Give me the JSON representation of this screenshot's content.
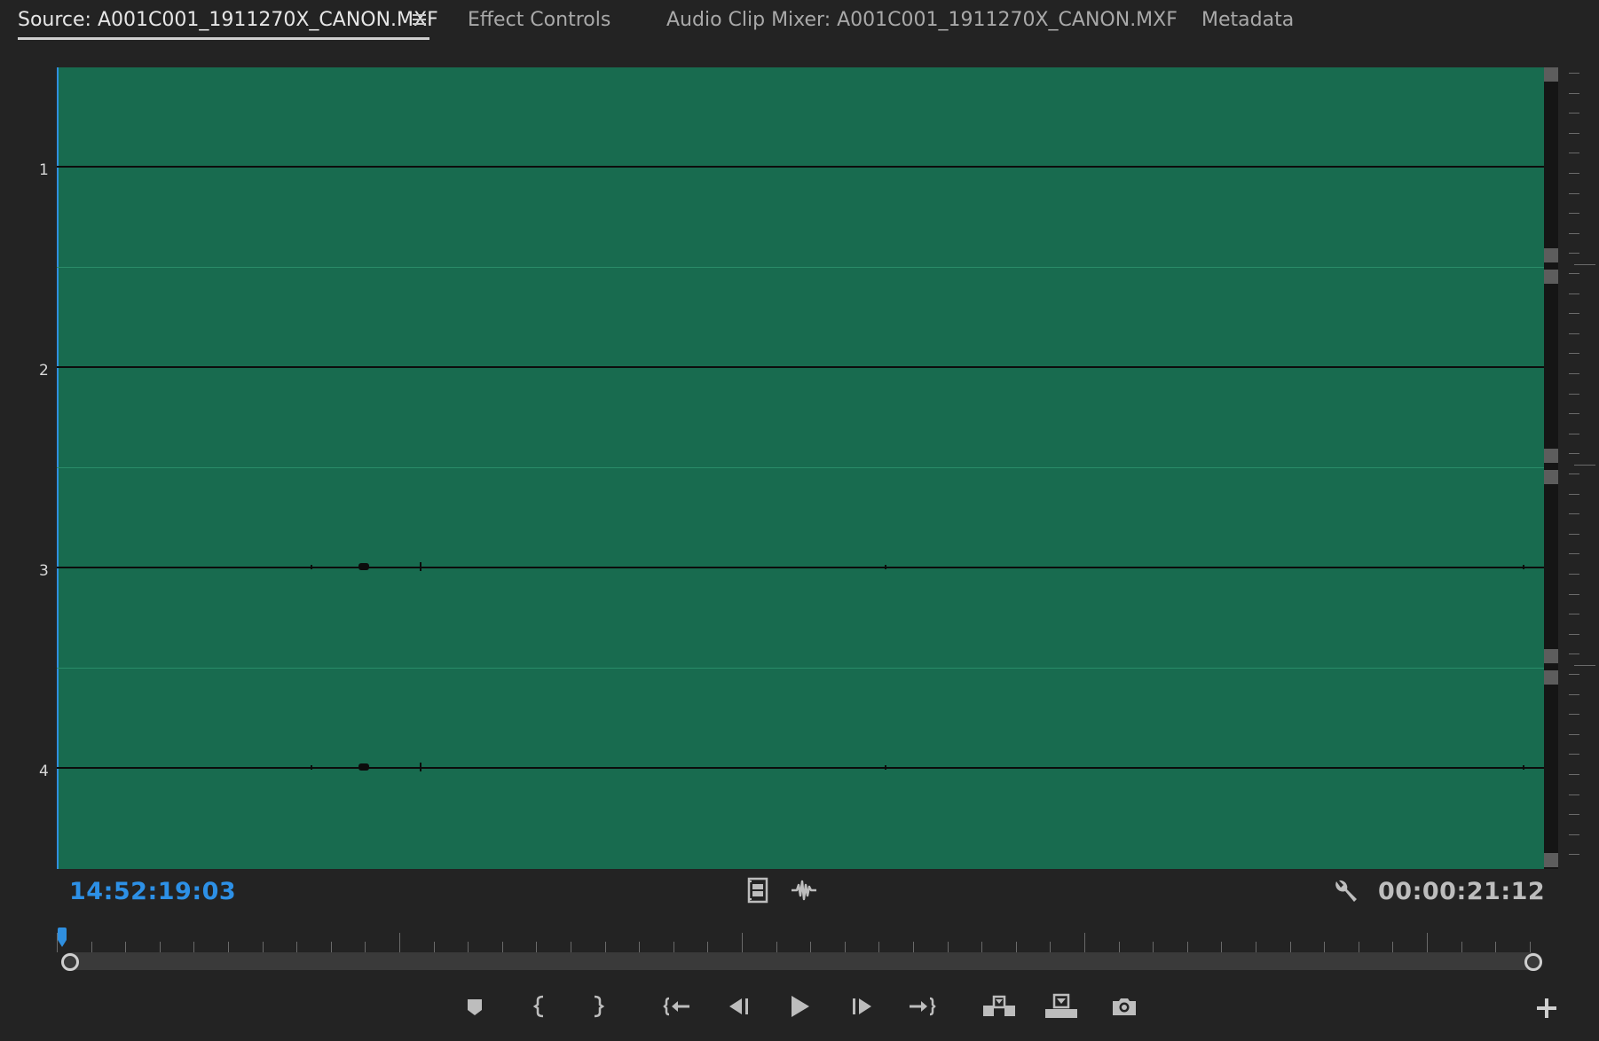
{
  "tabs": [
    {
      "label": "Source: A001C001_1911270X_CANON.MXF",
      "active": true
    },
    {
      "label": "Effect Controls",
      "active": false
    },
    {
      "label": "Audio Clip Mixer: A001C001_1911270X_CANON.MXF",
      "active": false
    },
    {
      "label": "Metadata",
      "active": false
    }
  ],
  "tab_menu_icon": "hamburger-menu-icon",
  "tracks": [
    {
      "label": "1"
    },
    {
      "label": "2"
    },
    {
      "label": "3"
    },
    {
      "label": "4"
    }
  ],
  "colors": {
    "waveform_bg": "#186b4f",
    "timecode_current": "#2d90e6",
    "playhead": "#2f8fe0",
    "panel_bg": "#232323"
  },
  "timecode": {
    "current": "14:52:19:03",
    "duration": "00:00:21:12"
  },
  "view_icons": [
    "film-strip-icon",
    "audio-waveform-icon"
  ],
  "settings_icon": "wrench-icon",
  "transport": [
    {
      "name": "add-marker-button",
      "icon": "marker-icon"
    },
    {
      "name": "mark-in-button",
      "icon": "mark-in-icon"
    },
    {
      "name": "mark-out-button",
      "icon": "mark-out-icon"
    },
    {
      "name": "go-to-in-button",
      "icon": "go-to-in-icon"
    },
    {
      "name": "step-back-button",
      "icon": "step-back-icon"
    },
    {
      "name": "play-button",
      "icon": "play-icon"
    },
    {
      "name": "step-forward-button",
      "icon": "step-forward-icon"
    },
    {
      "name": "go-to-out-button",
      "icon": "go-to-out-icon"
    },
    {
      "name": "insert-button",
      "icon": "insert-icon"
    },
    {
      "name": "overwrite-button",
      "icon": "overwrite-icon"
    },
    {
      "name": "export-frame-button",
      "icon": "camera-icon"
    }
  ],
  "add_button_icon": "plus-icon"
}
